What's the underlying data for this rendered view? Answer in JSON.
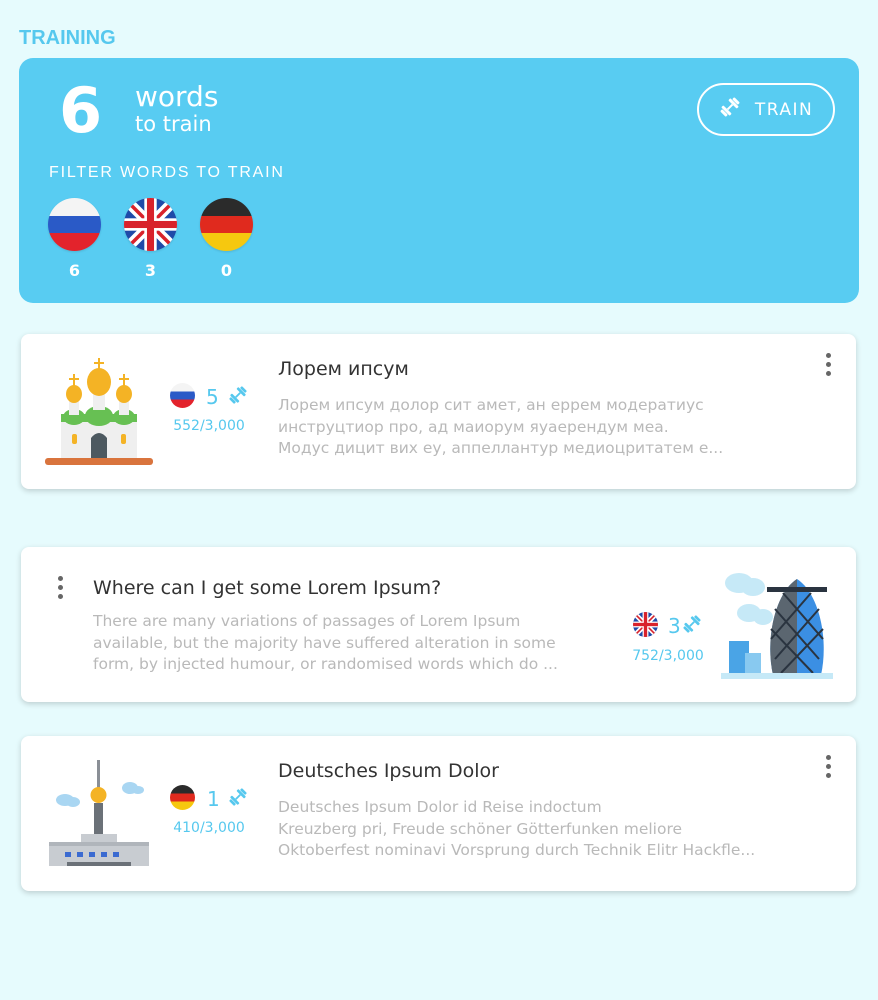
{
  "section": {
    "title": "TRAINING"
  },
  "training": {
    "count": "6",
    "words_label": "words",
    "words_sub": "to train",
    "train_button_label": "TRAIN",
    "filter_label": "FILTER WORDS TO TRAIN",
    "flags": [
      {
        "lang": "russian",
        "count": "6"
      },
      {
        "lang": "english",
        "count": "3"
      },
      {
        "lang": "german",
        "count": "0"
      }
    ]
  },
  "cards": [
    {
      "title": "Лорем ипсум",
      "description": [
        "Лорем ипсум долор сит амет, ан еррем модератиус",
        "инструцтиор про, ад маиорум яуаерендум меа.",
        "Модус дицит вих еу, аппеллантур медиоцритатем е..."
      ],
      "lang": "russian",
      "count": "5",
      "progress": "552/3,000",
      "illustration": "church-icon"
    },
    {
      "title": "Where can I get some Lorem Ipsum?",
      "description": [
        "There are many variations of passages of Lorem Ipsum",
        "available, but the majority have suffered alteration in some",
        "form, by injected humour, or randomised words which do ..."
      ],
      "lang": "english",
      "count": "3",
      "progress": "752/3,000",
      "illustration": "gherkin-tower-icon"
    },
    {
      "title": "Deutsches Ipsum Dolor",
      "description": [
        "Deutsches Ipsum Dolor id Reise indoctum",
        "Kreuzberg pri, Freude schöner Götterfunken meliore",
        "Oktoberfest nominavi Vorsprung durch Technik Elitr Hackfle..."
      ],
      "lang": "german",
      "count": "1",
      "progress": "410/3,000",
      "illustration": "tv-tower-icon"
    }
  ],
  "colors": {
    "accent": "#58ccf2",
    "background": "#e6fbfd",
    "text": "#333333",
    "muted": "#b9b9b9"
  }
}
